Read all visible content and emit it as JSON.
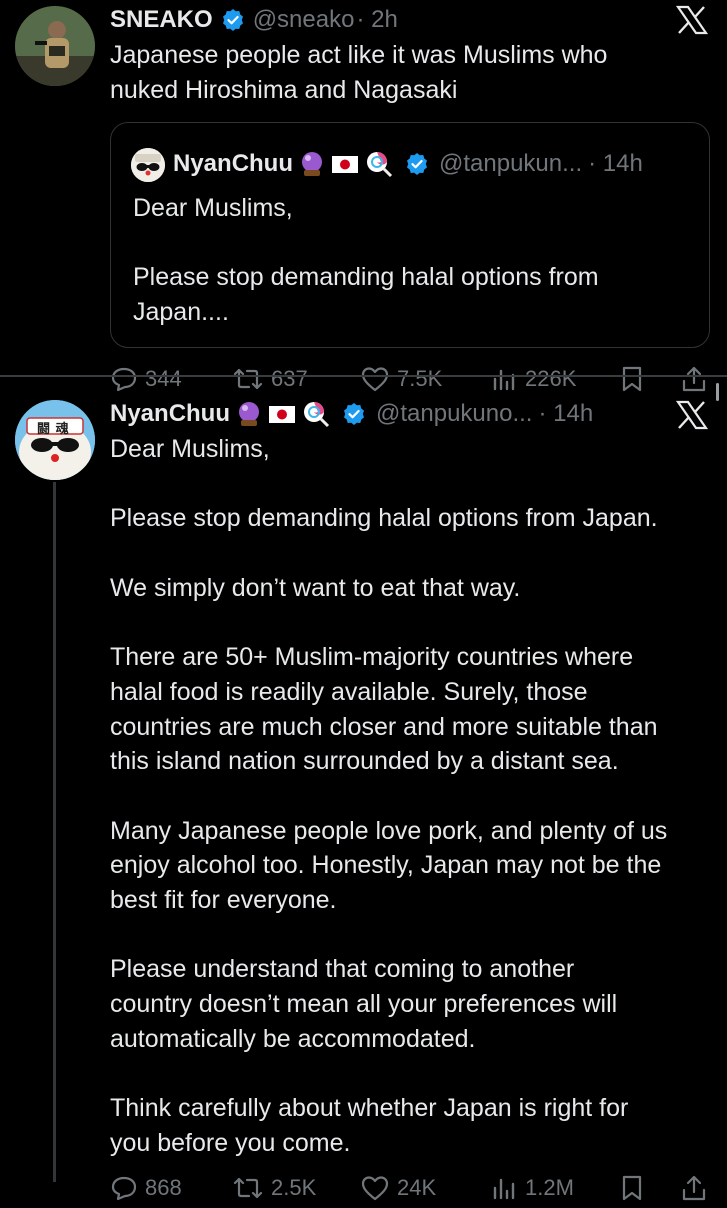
{
  "tweet1": {
    "author": "SNEAKO",
    "handle": "@sneako",
    "time": "· 2h",
    "text_line1": "Japanese people act like it was Muslims who",
    "text_line2": "nuked Hiroshima and Nagasaki",
    "quote": {
      "author": "NyanChuu",
      "handle": "@tanpukun...",
      "time": "· 14h",
      "line1": "Dear Muslims,",
      "line2": "Please stop demanding halal options from",
      "line3": "Japan...."
    },
    "actions": {
      "replies": "344",
      "reposts": "637",
      "likes": "7.5K",
      "views": "226K"
    }
  },
  "tweet2": {
    "author": "NyanChuu",
    "handle": "@tanpukuno...",
    "time": "· 14h",
    "avatar_text": "闘 魂",
    "lines": [
      "Dear Muslims,",
      "",
      "Please stop demanding halal options from Japan.",
      "",
      "We simply don’t want to eat that way.",
      "",
      "There are 50+ Muslim-majority countries where",
      "halal food is readily available. Surely, those",
      "countries are much closer and more suitable than",
      "this island nation surrounded by a distant sea.",
      "",
      "Many Japanese people love pork, and plenty of us",
      "enjoy alcohol too. Honestly, Japan may not be the",
      "best fit for everyone.",
      "",
      "Please understand that coming to another",
      "country doesn’t mean all your preferences will",
      "automatically be accommodated.",
      "",
      "Think carefully about whether Japan is right for",
      "you before you come."
    ],
    "actions": {
      "replies": "868",
      "reposts": "2.5K",
      "likes": "24K",
      "views": "1.2M"
    }
  },
  "colors": {
    "background": "#000000",
    "text": "#e7e9ea",
    "secondary": "#71767b",
    "verified": "#1d9bf0",
    "border": "#2f3336"
  },
  "icons": [
    "verified-badge-icon",
    "x-logo-icon",
    "reply-icon",
    "repost-icon",
    "like-icon",
    "views-icon",
    "bookmark-icon",
    "share-icon",
    "crystal-ball-emoji",
    "japan-flag-emoji",
    "lollipop-emoji"
  ]
}
